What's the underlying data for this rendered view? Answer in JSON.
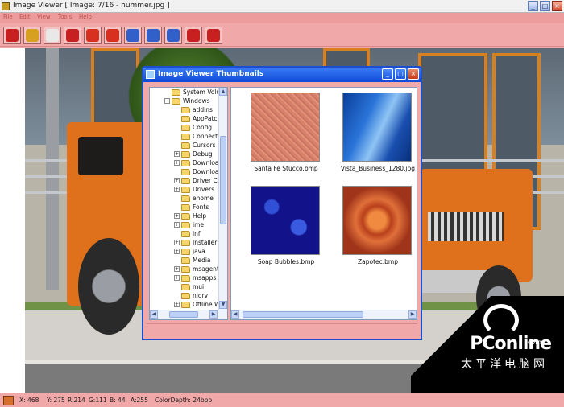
{
  "window": {
    "title": "Image Viewer [ Image: 7/16 - hummer.jpg ]",
    "buttons": {
      "minimize": "_",
      "maximize": "□",
      "close": "×"
    }
  },
  "menu": [
    {
      "label": "File"
    },
    {
      "label": "Edit"
    },
    {
      "label": "View"
    },
    {
      "label": "Tools"
    },
    {
      "label": "Help"
    }
  ],
  "toolbar": [
    {
      "name": "open-folder-icon",
      "color": "#c82020"
    },
    {
      "name": "save-icon",
      "color": "#d8a020"
    },
    {
      "name": "print-icon",
      "color": "#e8e8e8"
    },
    {
      "name": "thumbnails-icon",
      "color": "#c82020"
    },
    {
      "name": "previous-icon",
      "color": "#d83020"
    },
    {
      "name": "next-icon",
      "color": "#d83020"
    },
    {
      "name": "zoom-in-icon",
      "color": "#3060c8"
    },
    {
      "name": "zoom-out-icon",
      "color": "#3060c8"
    },
    {
      "name": "zoom-fit-icon",
      "color": "#3060c8"
    },
    {
      "name": "grid-icon",
      "color": "#c82020"
    },
    {
      "name": "stop-icon",
      "color": "#c82020"
    }
  ],
  "dialog": {
    "title": "Image Viewer Thumbnails",
    "buttons": {
      "minimize": "_",
      "maximize": "□",
      "close": "×"
    }
  },
  "tree": [
    {
      "label": "System Volum",
      "expander": ""
    },
    {
      "label": "Windows",
      "expander": "-"
    },
    {
      "label": "addins",
      "expander": ""
    },
    {
      "label": "AppPatch",
      "expander": ""
    },
    {
      "label": "Config",
      "expander": ""
    },
    {
      "label": "Connectio",
      "expander": ""
    },
    {
      "label": "Cursors",
      "expander": ""
    },
    {
      "label": "Debug",
      "expander": "+"
    },
    {
      "label": "Downloads",
      "expander": "+"
    },
    {
      "label": "Download",
      "expander": ""
    },
    {
      "label": "Driver Ca",
      "expander": "+"
    },
    {
      "label": "Drivers",
      "expander": "+"
    },
    {
      "label": "ehome",
      "expander": ""
    },
    {
      "label": "Fonts",
      "expander": ""
    },
    {
      "label": "Help",
      "expander": "+"
    },
    {
      "label": "ime",
      "expander": "+"
    },
    {
      "label": "inf",
      "expander": ""
    },
    {
      "label": "Installer",
      "expander": "+"
    },
    {
      "label": "java",
      "expander": "+"
    },
    {
      "label": "Media",
      "expander": ""
    },
    {
      "label": "msagent",
      "expander": "+"
    },
    {
      "label": "msapps",
      "expander": "+"
    },
    {
      "label": "mui",
      "expander": ""
    },
    {
      "label": "nldrv",
      "expander": ""
    },
    {
      "label": "Offline W",
      "expander": "+"
    }
  ],
  "thumbnails": [
    {
      "label": "Santa Fe Stucco.bmp",
      "style": "img-stucco"
    },
    {
      "label": "Vista_Business_1280.jpg",
      "style": "img-vista"
    },
    {
      "label": "Soap Bubbles.bmp",
      "style": "img-soap"
    },
    {
      "label": "Zapotec.bmp",
      "style": "img-zapotec"
    }
  ],
  "status": {
    "swatch_color": "#d66f2c",
    "x": "X: 468",
    "y": "Y: 275",
    "r": "R:214",
    "g": "G:111",
    "b": "B: 44",
    "a": "A:255",
    "depth": "ColorDepth: 24bpp"
  },
  "watermark": {
    "brand": "PConline",
    "domain": ".com.cn",
    "subtitle": "太平洋电脑网"
  }
}
